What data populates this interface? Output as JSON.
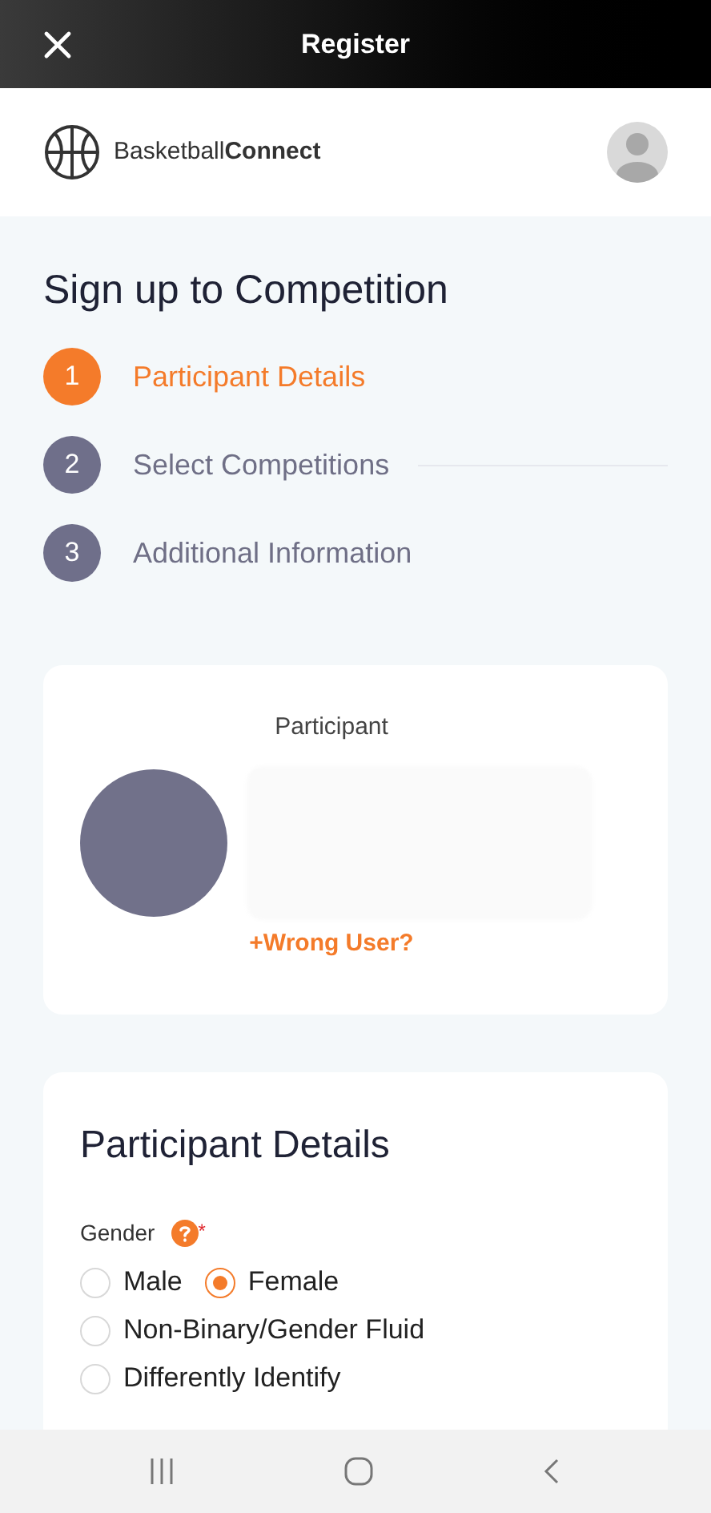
{
  "top_bar": {
    "title": "Register"
  },
  "brand": {
    "logo_text": "Basketball**Connect**"
  },
  "page_title": "Sign up to Competition",
  "steps": [
    {
      "number": "1",
      "label": "Participant Details",
      "selected": true
    },
    {
      "number": "2",
      "label": "Select Competitions",
      "selected": false
    },
    {
      "number": "3",
      "label": "Additional Information",
      "selected": false
    }
  ],
  "participant_card": {
    "heading": "Participant",
    "link": "+Wrong User?"
  },
  "details_card": {
    "heading": "Participant Details",
    "gender": {
      "label": "Gender",
      "required_mark": "*",
      "options": [
        {
          "label": "Male",
          "selected": false
        },
        {
          "label": "Female",
          "selected": true
        },
        {
          "label": "Non-Binary/Gender Fluid",
          "selected": false
        },
        {
          "label": "Differently Identify",
          "selected": false
        }
      ]
    }
  }
}
